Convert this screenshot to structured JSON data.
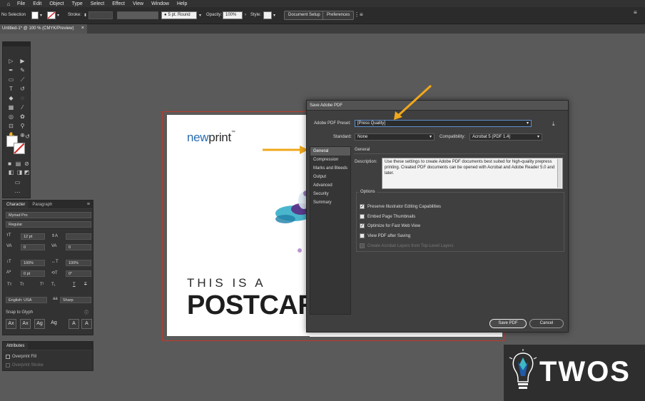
{
  "menubar": {
    "items": [
      "File",
      "Edit",
      "Object",
      "Type",
      "Select",
      "Effect",
      "View",
      "Window",
      "Help"
    ]
  },
  "control_bar": {
    "selection": "No Selection",
    "stroke_label": "Stroke:",
    "brush": "5 pt. Round",
    "opacity_label": "Opacity:",
    "opacity_value": "100%",
    "style_label": "Style:",
    "doc_setup": "Document Setup",
    "preferences": "Preferences"
  },
  "doc_tab": {
    "title": "Untitled-1* @ 100 % (CMYK/Preview)",
    "close": "×"
  },
  "character_panel": {
    "tab_character": "Character",
    "tab_paragraph": "Paragraph",
    "font_family": "Myriad Pro",
    "font_style": "Regular",
    "size": "12 pt",
    "leading": "",
    "kerning": "0",
    "tracking": "0",
    "vscale": "100%",
    "hscale": "100%",
    "baseline": "0 pt",
    "rotation": "0°",
    "language": "English: USA",
    "antialias": "Sharp",
    "snap_label": "Snap to Glyph",
    "glyph_buttons": [
      "Tт",
      "Tr",
      "T¹",
      "T₁",
      "T",
      "T"
    ]
  },
  "attributes_panel": {
    "title": "Attributes",
    "overprint_fill": "Overprint Fill",
    "overprint_stroke": "Overprint Stroke"
  },
  "artboard": {
    "logo_new": "new",
    "logo_print": "print",
    "logo_tm": "™",
    "line1": "THIS IS A",
    "line2": "POSTCARD"
  },
  "dialog": {
    "title": "Save Adobe PDF",
    "preset_label": "Adobe PDF Preset:",
    "preset_value": "[Press Quality]",
    "standard_label": "Standard:",
    "standard_value": "None",
    "compat_label": "Compatibility:",
    "compat_value": "Acrobat 5 (PDF 1.4)",
    "nav": [
      "General",
      "Compression",
      "Marks and Bleeds",
      "Output",
      "Advanced",
      "Security",
      "Summary"
    ],
    "section_title": "General",
    "description_label": "Description:",
    "description": "Use these settings to create Adobe PDF documents best suited for high-quality prepress printing.  Created PDF documents can be opened with Acrobat and Adobe Reader 5.0 and later.",
    "options_title": "Options",
    "options": [
      {
        "label": "Preserve Illustrator Editing Capabilities",
        "checked": true,
        "disabled": false
      },
      {
        "label": "Embed Page Thumbnails",
        "checked": false,
        "disabled": false
      },
      {
        "label": "Optimize for Fast Web View",
        "checked": true,
        "disabled": false
      },
      {
        "label": "View PDF after Saving",
        "checked": false,
        "disabled": false
      },
      {
        "label": "Create Acrobat Layers from Top-Level Layers",
        "checked": false,
        "disabled": true
      }
    ],
    "save_button": "Save PDF",
    "cancel_button": "Cancel"
  },
  "watermark": {
    "text": "TWOS"
  },
  "colors": {
    "arrow": "#f0a81c",
    "logo_teal": "#3fb7c6",
    "logo_blue": "#1f5ba8"
  }
}
